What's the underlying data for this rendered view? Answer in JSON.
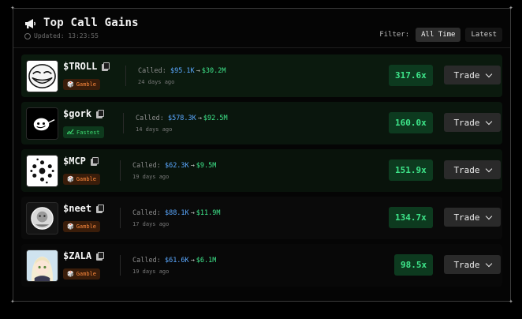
{
  "header": {
    "title": "Top Call Gains",
    "updated": "Updated: 13:23:55",
    "filter_label": "Filter:",
    "filters": [
      "All Time",
      "Latest"
    ]
  },
  "colors": {
    "accent_green": "#3ee58a",
    "from_blue": "#5aa8ff",
    "gamble_orange": "#ff8a3d"
  },
  "rows": [
    {
      "ticker": "$TROLL",
      "badge": "Gamble",
      "badge_icon": "gamble-icon",
      "called_label": "Called:",
      "from": "$95.1K",
      "arrow": "→",
      "to": "$30.2M",
      "ago": "24 days ago",
      "multiplier": "317.6x",
      "trade": "Trade"
    },
    {
      "ticker": "$gork",
      "badge": "Fastest",
      "badge_icon": "chart-up-icon",
      "called_label": "Called:",
      "from": "$578.3K",
      "arrow": "→",
      "to": "$92.5M",
      "ago": "14 days ago",
      "multiplier": "160.0x",
      "trade": "Trade"
    },
    {
      "ticker": "$MCP",
      "badge": "Gamble",
      "badge_icon": "gamble-icon",
      "called_label": "Called:",
      "from": "$62.3K",
      "arrow": "→",
      "to": "$9.5M",
      "ago": "19 days ago",
      "multiplier": "151.9x",
      "trade": "Trade"
    },
    {
      "ticker": "$neet",
      "badge": "Gamble",
      "badge_icon": "gamble-icon",
      "called_label": "Called:",
      "from": "$88.1K",
      "arrow": "→",
      "to": "$11.9M",
      "ago": "17 days ago",
      "multiplier": "134.7x",
      "trade": "Trade"
    },
    {
      "ticker": "$ZALA",
      "badge": "Gamble",
      "badge_icon": "gamble-icon",
      "called_label": "Called:",
      "from": "$61.6K",
      "arrow": "→",
      "to": "$6.1M",
      "ago": "19 days ago",
      "multiplier": "98.5x",
      "trade": "Trade"
    }
  ]
}
